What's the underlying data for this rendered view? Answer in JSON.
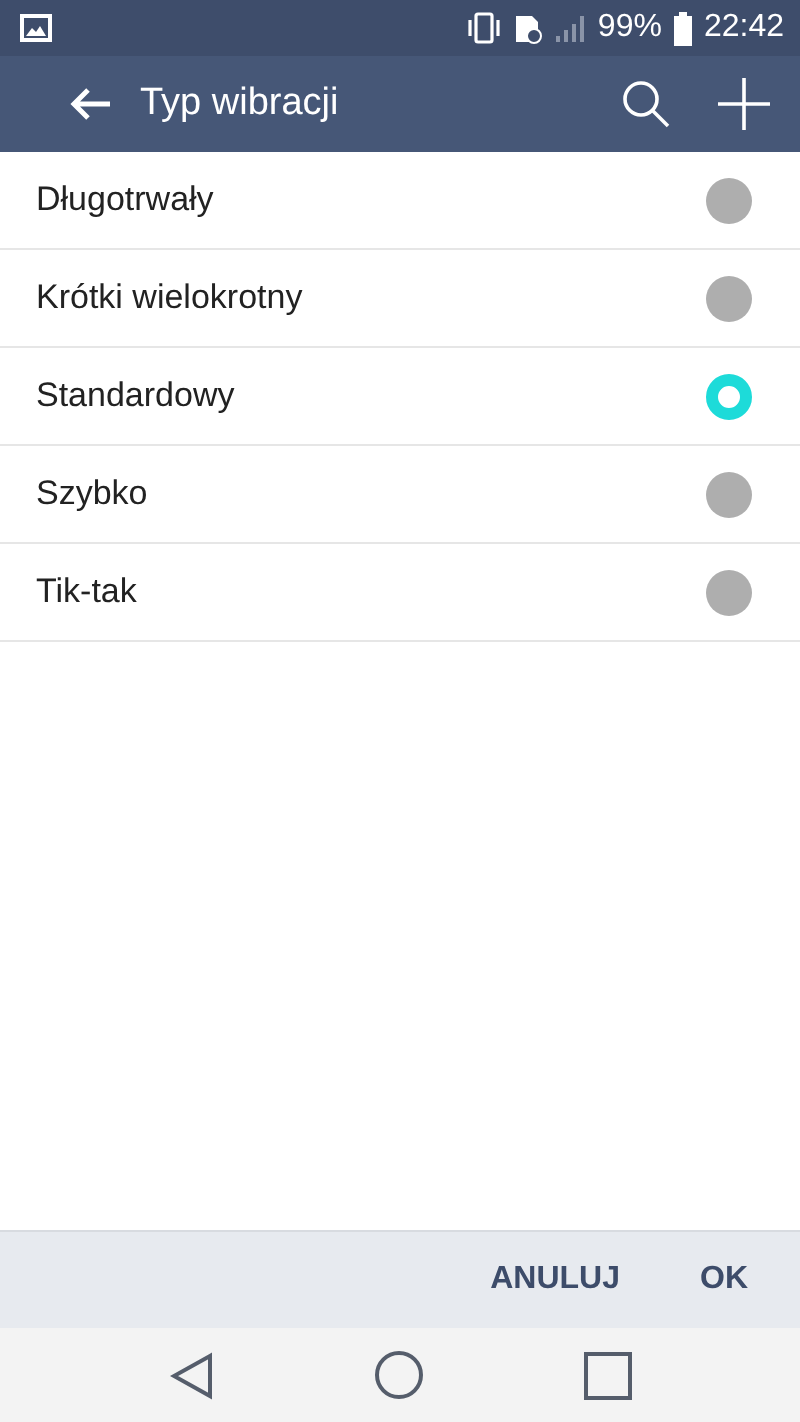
{
  "status_bar": {
    "battery": "99%",
    "time": "22:42"
  },
  "toolbar": {
    "title": "Typ wibracji"
  },
  "options": [
    {
      "label": "Długotrwały",
      "selected": false
    },
    {
      "label": "Krótki wielokrotny",
      "selected": false
    },
    {
      "label": "Standardowy",
      "selected": true
    },
    {
      "label": "Szybko",
      "selected": false
    },
    {
      "label": "Tik-tak",
      "selected": false
    }
  ],
  "buttons": [
    "ANULUJ",
    "OK"
  ]
}
